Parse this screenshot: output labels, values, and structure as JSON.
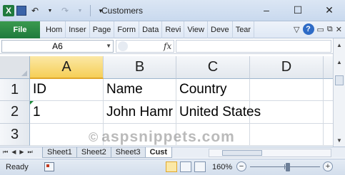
{
  "window": {
    "title": "Customers",
    "controls": [
      "–",
      "☐",
      "✕"
    ]
  },
  "ribbon": {
    "file_label": "File",
    "tabs": [
      "Hom",
      "Inser",
      "Page",
      "Form",
      "Data",
      "Revi",
      "View",
      "Deve",
      "Tear"
    ],
    "right_glyphs": [
      "▽",
      "?",
      "▭",
      "⧉",
      "✕"
    ]
  },
  "formula_bar": {
    "name_box": "A6",
    "fx_label": "fx",
    "value": ""
  },
  "grid": {
    "columns": [
      "A",
      "B",
      "C",
      "D"
    ],
    "rows": [
      "1",
      "2",
      "3"
    ],
    "cells": {
      "A1": "ID",
      "B1": "Name",
      "C1": "Country",
      "A2": "1",
      "B2": "John Hamr",
      "C2": "United States"
    }
  },
  "watermark": {
    "symbol": "©",
    "text": "aspsnippets.com"
  },
  "sheets": {
    "nav_glyphs": [
      "⏮",
      "◀",
      "▶",
      "⏭"
    ],
    "tabs": [
      "Sheet1",
      "Sheet2",
      "Sheet3",
      "Cust"
    ],
    "active_index": 3
  },
  "status": {
    "ready": "Ready",
    "zoom": "160%",
    "zoom_minus": "−",
    "zoom_plus": "+"
  }
}
